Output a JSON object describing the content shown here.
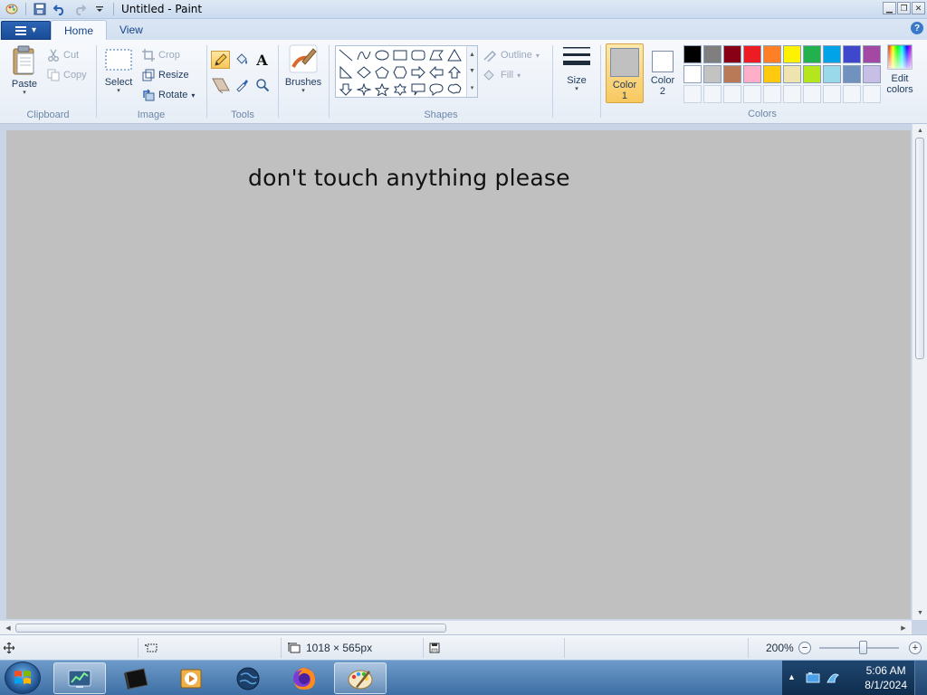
{
  "window": {
    "title": "Untitled - Paint",
    "controls": [
      "minimize",
      "maximize",
      "close"
    ]
  },
  "tabs": [
    {
      "label": "Home",
      "active": true
    },
    {
      "label": "View",
      "active": false
    }
  ],
  "ribbon": {
    "clipboard": {
      "group_label": "Clipboard",
      "paste": "Paste",
      "cut": "Cut",
      "copy": "Copy"
    },
    "image": {
      "group_label": "Image",
      "select": "Select",
      "crop": "Crop",
      "resize": "Resize",
      "rotate": "Rotate"
    },
    "tools": {
      "group_label": "Tools",
      "items": [
        "pencil-icon",
        "fill-icon",
        "text-icon",
        "eraser-icon",
        "color-picker-icon",
        "magnifier-icon"
      ],
      "selected": "pencil-icon"
    },
    "brushes": {
      "label": "Brushes"
    },
    "shapes": {
      "group_label": "Shapes",
      "outline": "Outline",
      "fill": "Fill"
    },
    "size": {
      "label": "Size"
    },
    "colors": {
      "group_label": "Colors",
      "color1_label": "Color\n1",
      "color1_line1": "Color",
      "color1_line2": "1",
      "color2_line1": "Color",
      "color2_line2": "2",
      "color1_value": "#c0c0c0",
      "color2_value": "#ffffff",
      "edit_line1": "Edit",
      "edit_line2": "colors",
      "palette_row1": [
        "#000000",
        "#7f7f7f",
        "#880015",
        "#ed1c24",
        "#ff7f27",
        "#fff200",
        "#22b14c",
        "#00a2e8",
        "#3f48cc",
        "#a349a4"
      ],
      "palette_row2": [
        "#ffffff",
        "#c3c3c3",
        "#b97a57",
        "#ffaec9",
        "#ffc90e",
        "#efe4b0",
        "#b5e61d",
        "#99d9ea",
        "#7092be",
        "#c8bfe7"
      ]
    }
  },
  "canvas": {
    "text": "don't touch anything please",
    "background": "#c0c0c0"
  },
  "statusbar": {
    "dimensions": "1018 × 565px",
    "zoom": "200%",
    "zoom_level_fraction": 0.55
  },
  "taskbar": {
    "apps": [
      "task-manager-icon",
      "terminal-icon",
      "media-player-icon",
      "globe-icon",
      "firefox-icon",
      "paint-icon"
    ],
    "time": "5:06 AM",
    "date": "8/1/2024"
  }
}
